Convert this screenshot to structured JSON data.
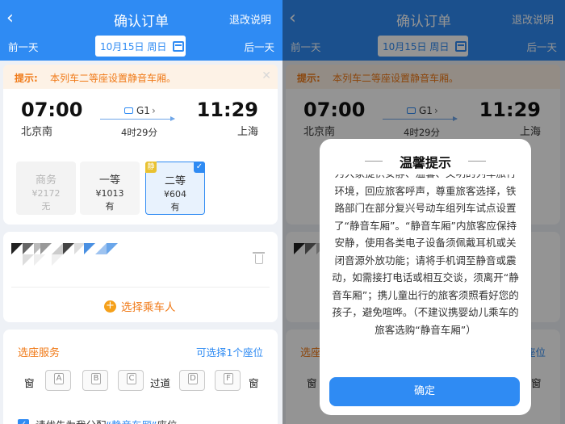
{
  "header": {
    "title": "确认订单",
    "refund_link": "退改说明",
    "prev_day": "前一天",
    "next_day": "后一天",
    "date": "10月15日 周日"
  },
  "tip": {
    "label": "提示:",
    "text": "本列车二等座设置静音车厢。"
  },
  "train": {
    "depart_time": "07:00",
    "depart_station": "北京南",
    "arrive_time": "11:29",
    "arrive_station": "上海",
    "number": "G1",
    "duration": "4时29分"
  },
  "seats": [
    {
      "name": "商务",
      "price": "¥2172",
      "availability": "无"
    },
    {
      "name": "一等",
      "price": "¥1013",
      "availability": "有"
    },
    {
      "name": "二等",
      "price": "¥604",
      "availability": "有",
      "badge": "静"
    }
  ],
  "passenger": {
    "add_label": "选择乘车人"
  },
  "seat_selection": {
    "title": "选座服务",
    "hint": "可选择1个座位",
    "window": "窗",
    "aisle": "过道",
    "seat_letters": [
      "A",
      "B",
      "C",
      "D",
      "F"
    ],
    "preference_prefix": "请优先为我分配",
    "preference_link": "“静音车厢”",
    "preference_suffix": "座位"
  },
  "modal": {
    "title": "温馨提示",
    "body": "为大家提供安静、温馨、文明的列车旅行环境，回应旅客呼声，尊重旅客选择，铁路部门在部分复兴号动车组列车试点设置了“静音车厢”。“静音车厢”内旅客应保持安静，使用各类电子设备须佩戴耳机或关闭音源外放功能；请将手机调至静音或震动，如需接打电话或相互交谈，须离开“静音车厢”；携儿童出行的旅客须照看好您的孩子，避免喧哗。（不建议携婴幼儿乘车的旅客选购“静音车厢”）",
    "confirm": "确定"
  },
  "colors": {
    "brand": "#2f8bf3",
    "warning": "#f07a18",
    "badge": "#e9c231"
  }
}
